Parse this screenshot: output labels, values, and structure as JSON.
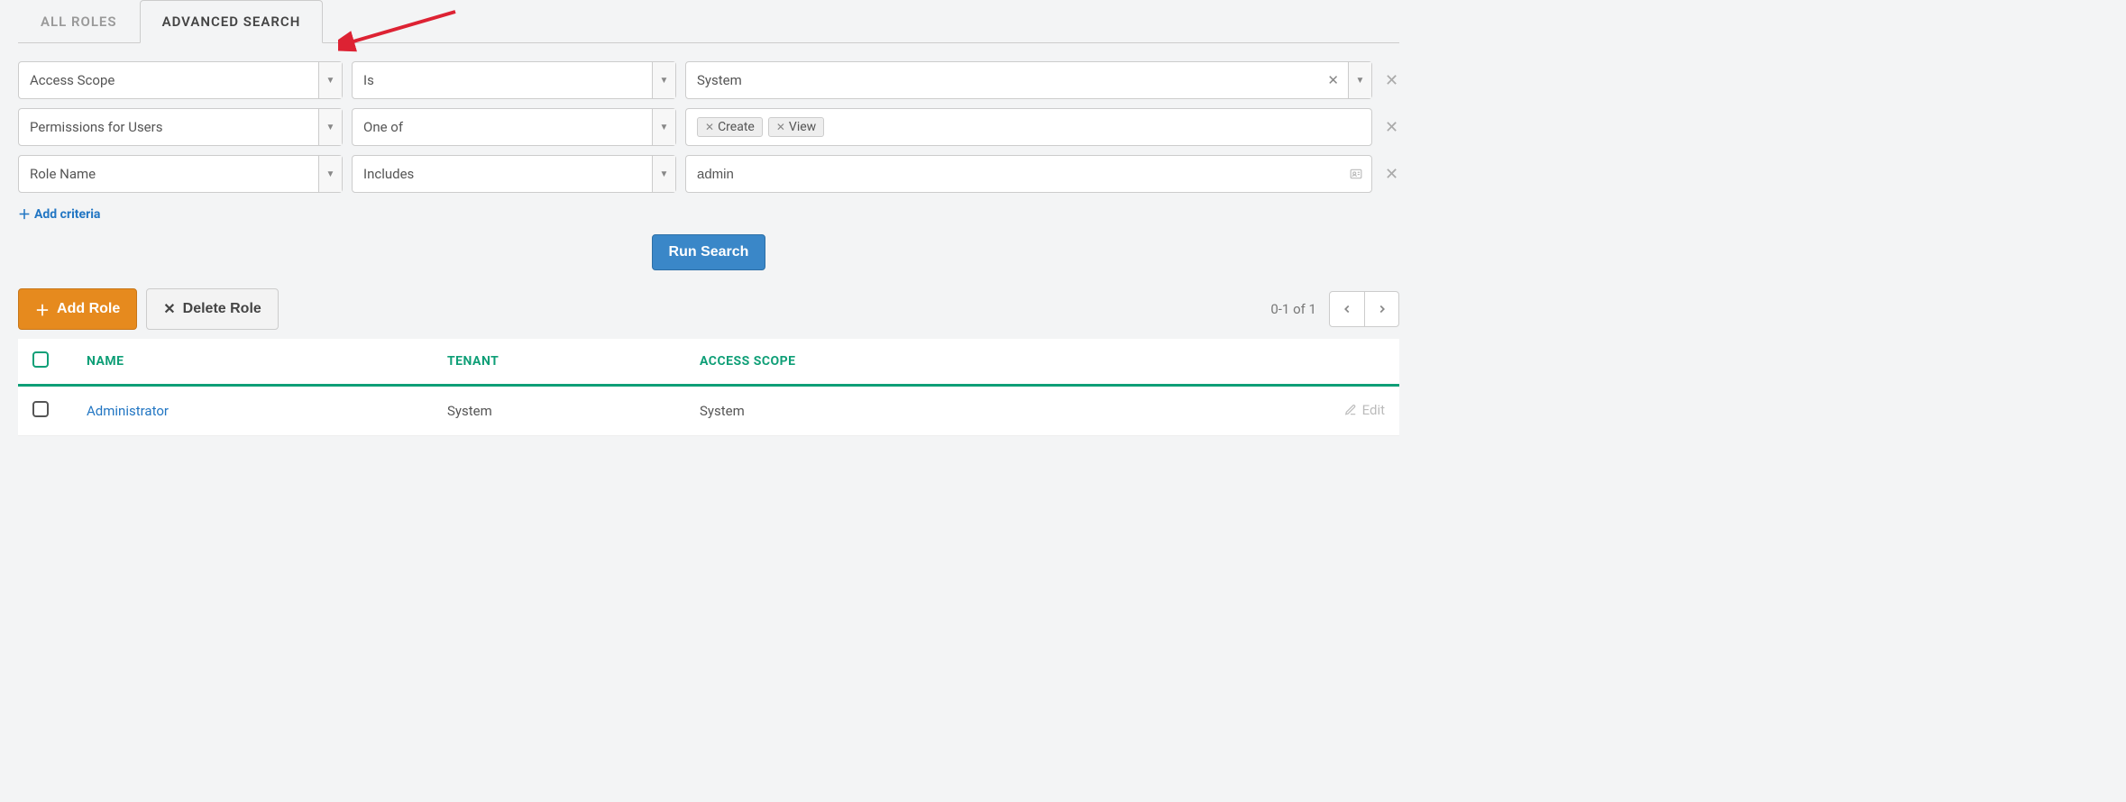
{
  "tabs": {
    "all_roles": "ALL ROLES",
    "advanced_search": "ADVANCED SEARCH"
  },
  "criteria": [
    {
      "field": "Access Scope",
      "operator": "Is",
      "value_type": "single",
      "value": "System"
    },
    {
      "field": "Permissions for Users",
      "operator": "One of",
      "value_type": "tags",
      "tags": [
        "Create",
        "View"
      ]
    },
    {
      "field": "Role Name",
      "operator": "Includes",
      "value_type": "text",
      "value": "admin"
    }
  ],
  "add_criteria_label": "Add criteria",
  "run_search_label": "Run Search",
  "toolbar": {
    "add_role": "Add Role",
    "delete_role": "Delete Role",
    "range": "0-1 of 1"
  },
  "table": {
    "headers": {
      "name": "NAME",
      "tenant": "TENANT",
      "access_scope": "ACCESS SCOPE"
    },
    "rows": [
      {
        "name": "Administrator",
        "tenant": "System",
        "access_scope": "System",
        "edit_label": "Edit"
      }
    ]
  }
}
